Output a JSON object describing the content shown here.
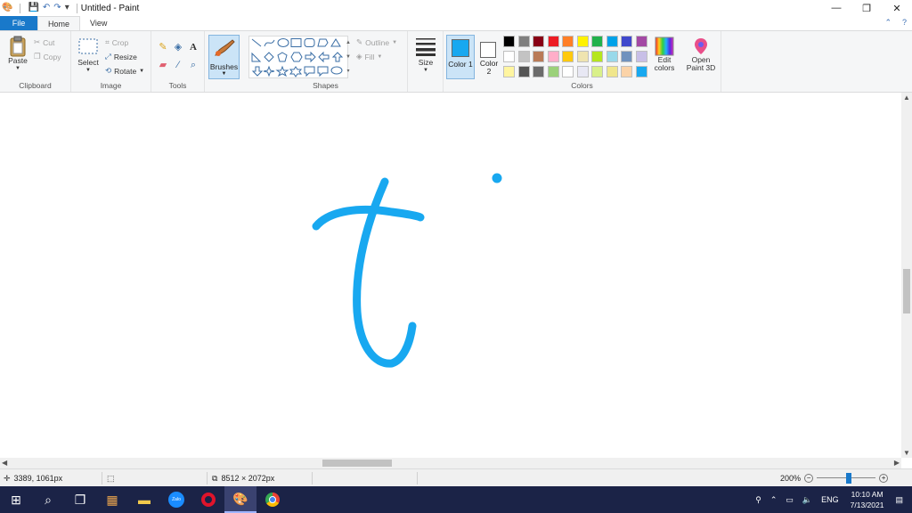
{
  "titlebar": {
    "title": "Untitled - Paint",
    "minimize": "—",
    "restore": "❐",
    "close": "✕"
  },
  "menu": {
    "file": "File",
    "home": "Home",
    "view": "View"
  },
  "ribbon": {
    "clipboard": {
      "label": "Clipboard",
      "paste": "Paste",
      "cut": "Cut",
      "copy": "Copy"
    },
    "image": {
      "label": "Image",
      "select": "Select",
      "crop": "Crop",
      "resize": "Resize",
      "rotate": "Rotate"
    },
    "tools": {
      "label": "Tools"
    },
    "brushes": {
      "label": "Brushes"
    },
    "shapes": {
      "label": "Shapes",
      "outline": "Outline",
      "fill": "Fill"
    },
    "size": {
      "label": "Size"
    },
    "colors": {
      "label": "Colors",
      "color1_label": "Color 1",
      "color2_label": "Color 2",
      "color1": "#18a8f0",
      "color2": "#ffffff",
      "edit_colors": "Edit colors",
      "palette": [
        "#000000",
        "#7f7f7f",
        "#880015",
        "#ed1c24",
        "#ff7f27",
        "#fff200",
        "#22b14c",
        "#00a2e8",
        "#3f48cc",
        "#a349a4",
        "#ffffff",
        "#c3c3c3",
        "#b97a57",
        "#ffaec9",
        "#ffc90e",
        "#efe4b0",
        "#b5e61d",
        "#99d9ea",
        "#7092be",
        "#c8bfe7",
        "#fff5a0",
        "#555555",
        "#6b6b6b",
        "#9bd17a",
        "#ffffff",
        "#e8e8f4",
        "#d9f08a",
        "#f0e68c",
        "#fbd3a8",
        "#18a8f0"
      ]
    },
    "paint3d": "Open Paint 3D"
  },
  "canvas": {
    "stroke_color": "#18a8f0"
  },
  "statusbar": {
    "cursor_pos": "3389, 1061px",
    "image_size": "8512 × 2072px",
    "zoom": "200%"
  },
  "taskbar": {
    "time": "10:10 AM",
    "date": "7/13/2021",
    "lang": "ENG"
  }
}
